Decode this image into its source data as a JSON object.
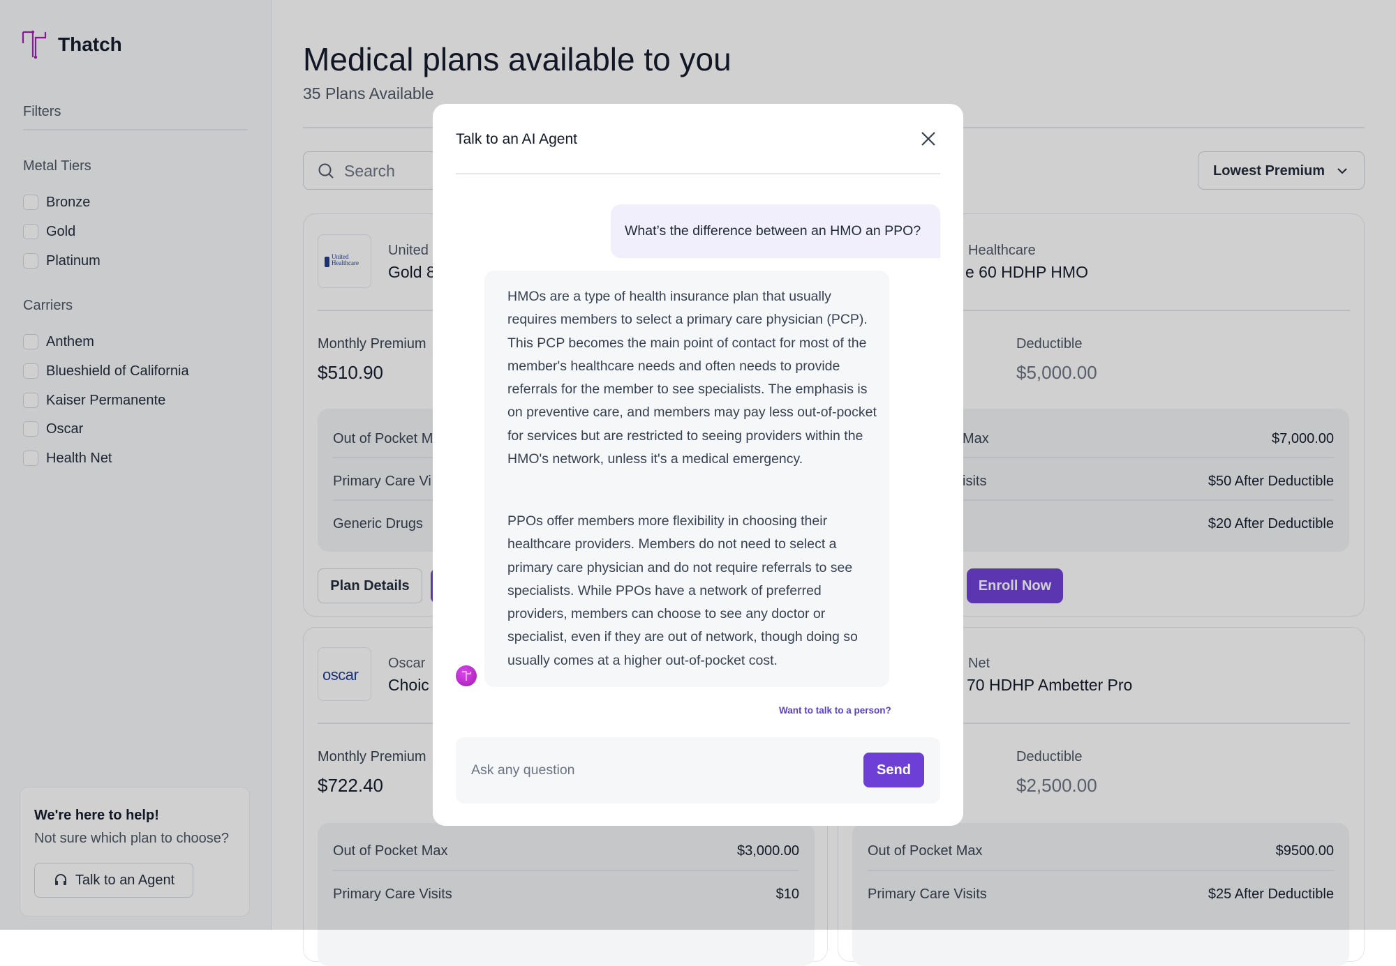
{
  "app": {
    "name": "Thatch",
    "brand_color": "#a21caf",
    "accent": "#6d3fd6",
    "logo_icon": "thatch-t-logo"
  },
  "sidebar": {
    "filters_label": "Filters",
    "metal_tiers": {
      "title": "Metal Tiers",
      "items": [
        {
          "label": "Bronze",
          "checked": false
        },
        {
          "label": "Gold",
          "checked": false
        },
        {
          "label": "Platinum",
          "checked": false
        }
      ]
    },
    "carriers": {
      "title": "Carriers",
      "items": [
        {
          "label": "Anthem",
          "checked": false
        },
        {
          "label": "Blueshield of California",
          "checked": false
        },
        {
          "label": "Kaiser Permanente",
          "checked": false
        },
        {
          "label": "Oscar",
          "checked": false
        },
        {
          "label": "Health Net",
          "checked": false
        }
      ]
    },
    "help": {
      "title": "We're here to help!",
      "subtitle": "Not sure which plan to choose?",
      "button": "Talk to an Agent",
      "button_icon": "headset-icon"
    }
  },
  "main": {
    "title": "Medical plans available to you",
    "subtitle": "35 Plans Available",
    "search_placeholder": "Search",
    "sort": {
      "selected": "Lowest Premium"
    },
    "cards": [
      {
        "carrier": "United",
        "logo_text": "United Healthcare",
        "plan": "Gold 8",
        "premium_label": "Monthly Premium",
        "premium": "$510.90",
        "rows": [
          {
            "label": "Out of Pocket M"
          },
          {
            "label": "Primary Care Vi"
          },
          {
            "label": "Generic Drugs"
          }
        ],
        "details_button": "Plan Details"
      },
      {
        "carrier": "Healthcare",
        "plan": "e 60 HDHP HMO",
        "deductible_label": "Deductible",
        "deductible": "$5,000.00",
        "rows": [
          {
            "label": "Max",
            "value": "$7,000.00"
          },
          {
            "label": "isits",
            "value": "$50 After Deductible"
          },
          {
            "label": "",
            "value": "$20 After Deductible"
          }
        ],
        "enroll_button": "Enroll Now"
      },
      {
        "carrier": "Oscar",
        "logo_text": "oscar",
        "plan": "Choic",
        "premium_label": "Monthly Premium",
        "premium": "$722.40",
        "rows": [
          {
            "label": "Out of Pocket Max",
            "value": "$3,000.00"
          },
          {
            "label": "Primary Care Visits",
            "value": "$10"
          }
        ]
      },
      {
        "carrier": "Net",
        "plan": "70 HDHP Ambetter Pro",
        "deductible_label": "Deductible",
        "deductible": "$2,500.00",
        "rows": [
          {
            "label": "Out of Pocket Max",
            "value": "$9500.00"
          },
          {
            "label": "Primary Care Visits",
            "value": "$25 After Deductible"
          }
        ]
      }
    ]
  },
  "modal": {
    "title": "Talk to an AI Agent",
    "user_message": "What’s the difference between an HMO an PPO?",
    "assistant_paragraphs": [
      "HMOs are a type of health insurance plan that usually requires members to select a primary care physician (PCP). This PCP becomes the main point of contact for most of the member's healthcare needs and often needs to provide referrals for the member to see specialists. The emphasis is on preventive care, and members may pay less out-of-pocket for services but are restricted to seeing providers within the HMO's network, unless it's a medical emergency.",
      "PPOs offer members more flexibility in choosing their healthcare providers. Members do not need to select a primary care physician and do not require referrals to see specialists. While PPOs have a network of preferred providers, members can choose to see any doctor or specialist, even if they are out of network, though doing so usually comes at a higher out-of-pocket cost."
    ],
    "human_link": "Want to talk to a person?",
    "input_placeholder": "Ask any question",
    "send_button": "Send"
  }
}
